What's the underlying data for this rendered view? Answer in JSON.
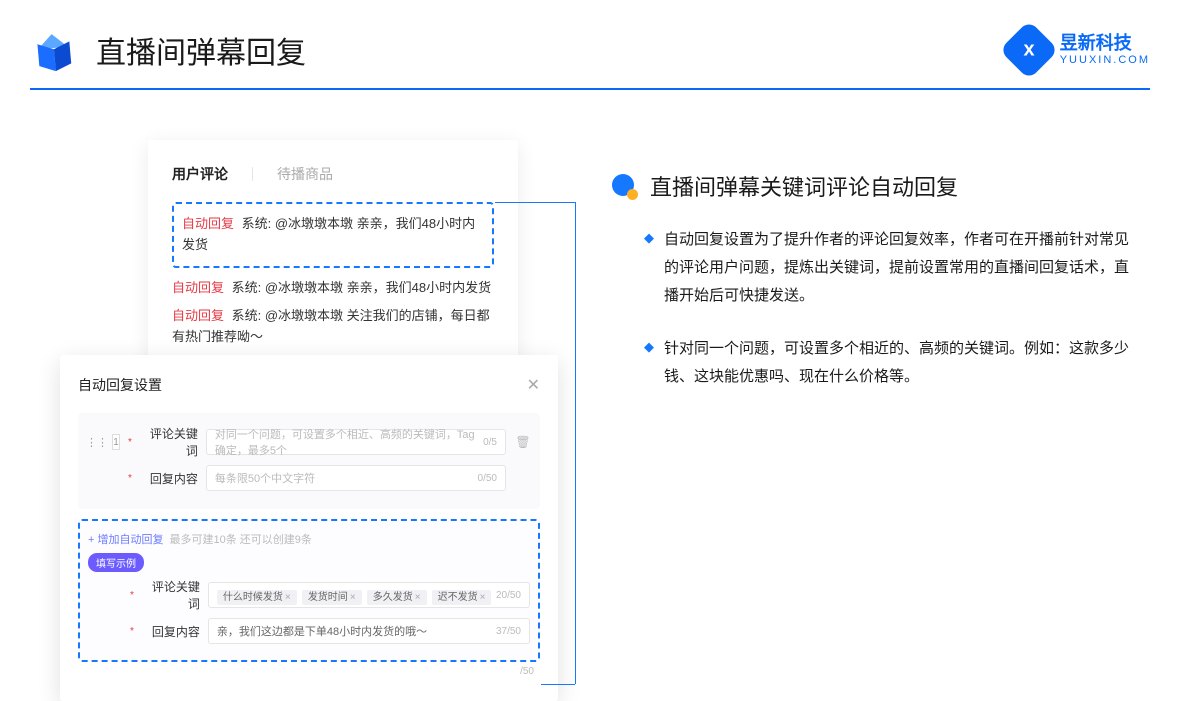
{
  "header": {
    "title": "直播间弹幕回复",
    "brand_name": "昱新科技",
    "brand_url": "YUUXIN.COM"
  },
  "comments_card": {
    "tab_active": "用户评论",
    "tab_inactive": "待播商品",
    "highlighted_line": "系统: @冰墩墩本墩 亲亲，我们48小时内发货",
    "lines": [
      "系统: @冰墩墩本墩 亲亲，我们48小时内发货",
      "系统: @冰墩墩本墩 关注我们的店铺，每日都有热门推荐呦～"
    ],
    "auto_tag": "自动回复"
  },
  "settings": {
    "title": "自动回复设置",
    "idx": "1",
    "label_keyword": "评论关键词",
    "label_content": "回复内容",
    "placeholder_keyword": "对同一个问题，可设置多个相近、高频的关键词，Tag确定，最多5个",
    "placeholder_content": "每条限50个中文字符",
    "counter_kw": "0/5",
    "counter_ct": "0/50",
    "add_link": "+ 增加自动回复",
    "add_hint": "最多可建10条 还可以创建9条",
    "example_badge": "填写示例",
    "example_tags": [
      "什么时候发货",
      "发货时间",
      "多久发货",
      "迟不发货"
    ],
    "example_kw_counter": "20/50",
    "example_content": "亲，我们这边都是下单48小时内发货的哦～",
    "example_ct_counter": "37/50",
    "trailing_counter": "/50"
  },
  "right": {
    "section_title": "直播间弹幕关键词评论自动回复",
    "bullets": [
      "自动回复设置为了提升作者的评论回复效率，作者可在开播前针对常见的评论用户问题，提炼出关键词，提前设置常用的直播间回复话术，直播开始后可快捷发送。",
      "针对同一个问题，可设置多个相近的、高频的关键词。例如：这款多少钱、这块能优惠吗、现在什么价格等。"
    ]
  }
}
